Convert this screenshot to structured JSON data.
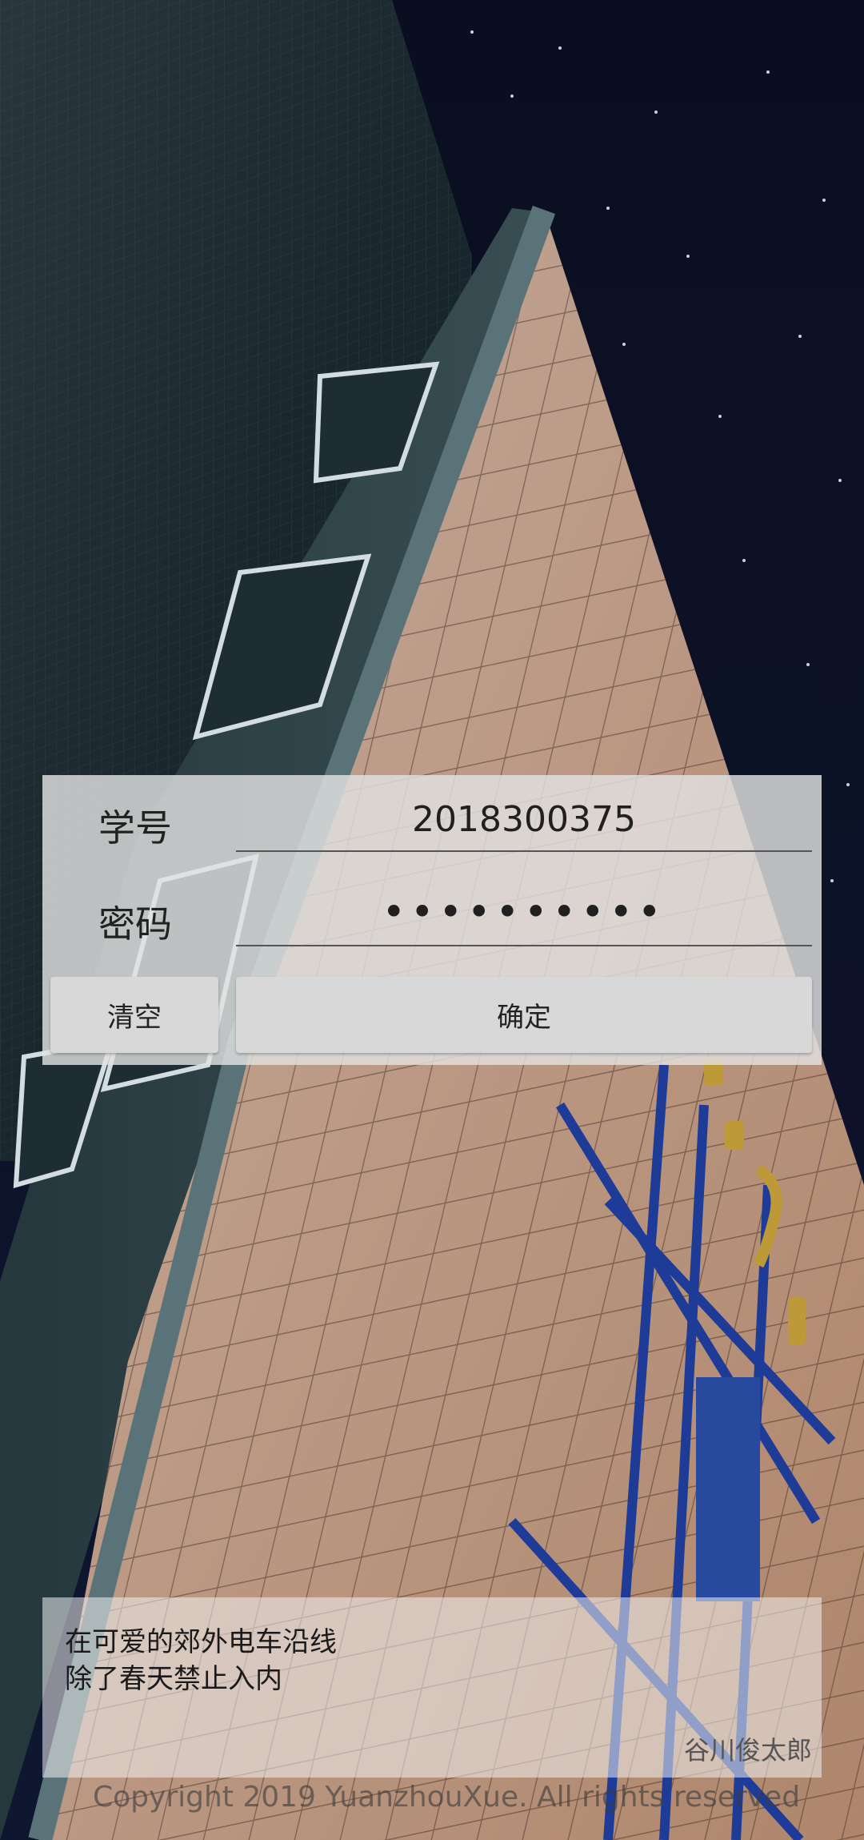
{
  "login": {
    "student_id_label": "学号",
    "student_id_value": "2018300375",
    "password_label": "密码",
    "password_value": "••••••••••",
    "clear_button": "清空",
    "confirm_button": "确定"
  },
  "quote": {
    "line1": "在可爱的郊外电车沿线",
    "line2": "除了春天禁止入内",
    "author": "谷川俊太郎"
  },
  "footer": {
    "copyright": "Copyright 2019 YuanzhouXue. All rights reserved"
  },
  "colors": {
    "panel": "#e2e2e2",
    "button": "#d8d8d8",
    "text": "#222222"
  },
  "background": {
    "subject": "building-night-sky-photo"
  }
}
